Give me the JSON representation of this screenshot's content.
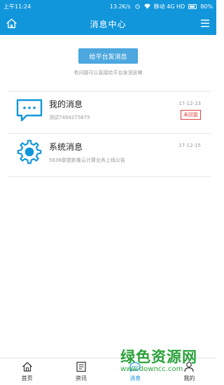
{
  "status": {
    "time": "上午11:24",
    "speed": "13.2K/s",
    "carrier": "移动 4G HD",
    "battery": "80%"
  },
  "header": {
    "title": "消息中心"
  },
  "actions": {
    "send_label": "给平台发消息",
    "hint": "有问题可以直接给平台发消息嘛"
  },
  "messages": [
    {
      "name": "我的消息",
      "sub": "测试7494275675",
      "date": "17-12-23",
      "badge": "未回复",
      "icon": "chat-bubble-icon"
    },
    {
      "name": "系统消息",
      "sub": "5636联盟新推云计算业务上线公告",
      "date": "17-12-15",
      "icon": "gear-icon"
    }
  ],
  "tabs": [
    {
      "label": "首页",
      "icon": "home-icon"
    },
    {
      "label": "资讯",
      "icon": "news-icon"
    },
    {
      "label": "消息",
      "icon": "message-icon",
      "active": true
    },
    {
      "label": "我的",
      "icon": "user-icon"
    }
  ],
  "watermark": {
    "line1": "绿色资源网",
    "line2": "www.downcc.com"
  },
  "colors": {
    "primary": "#1296db",
    "button": "#4ca7de",
    "badge": "#e04040",
    "watermark": "#2aa23a"
  }
}
